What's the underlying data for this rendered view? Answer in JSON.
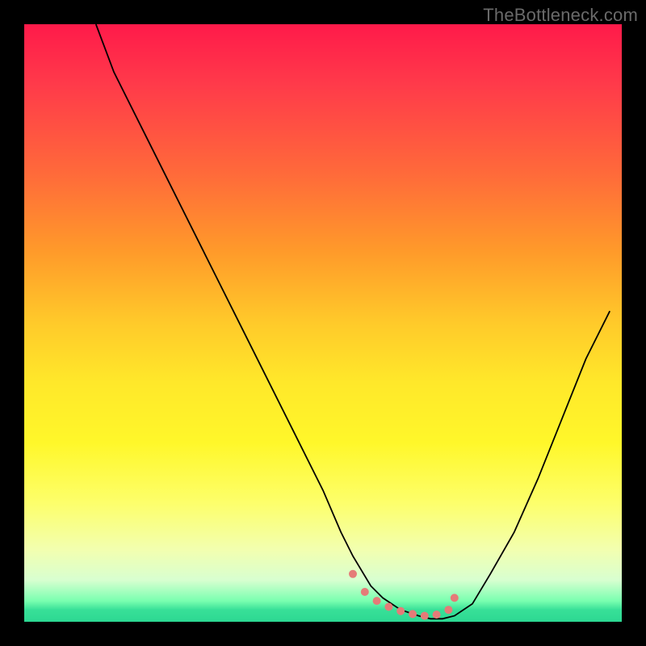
{
  "watermark": "TheBottleneck.com",
  "colors": {
    "curve_stroke": "#000000",
    "marker_fill": "#e57b78",
    "marker_stroke": "#d66a66"
  },
  "chart_data": {
    "type": "line",
    "title": "",
    "xlabel": "",
    "ylabel": "",
    "xlim": [
      0,
      100
    ],
    "ylim": [
      0,
      100
    ],
    "series": [
      {
        "name": "bottleneck-curve",
        "x": [
          12,
          15,
          20,
          25,
          30,
          35,
          40,
          45,
          50,
          53,
          55,
          58,
          60,
          63,
          66,
          68,
          70,
          72,
          75,
          78,
          82,
          86,
          90,
          94,
          98
        ],
        "values": [
          100,
          92,
          82,
          72,
          62,
          52,
          42,
          32,
          22,
          15,
          11,
          6,
          4,
          2,
          1,
          0.5,
          0.5,
          1,
          3,
          8,
          15,
          24,
          34,
          44,
          52
        ]
      }
    ],
    "markers": {
      "name": "highlighted-range",
      "x": [
        55,
        57,
        59,
        61,
        63,
        65,
        67,
        69,
        71,
        72
      ],
      "values": [
        8,
        5,
        3.5,
        2.5,
        1.8,
        1.3,
        1,
        1.2,
        2,
        4
      ]
    }
  }
}
